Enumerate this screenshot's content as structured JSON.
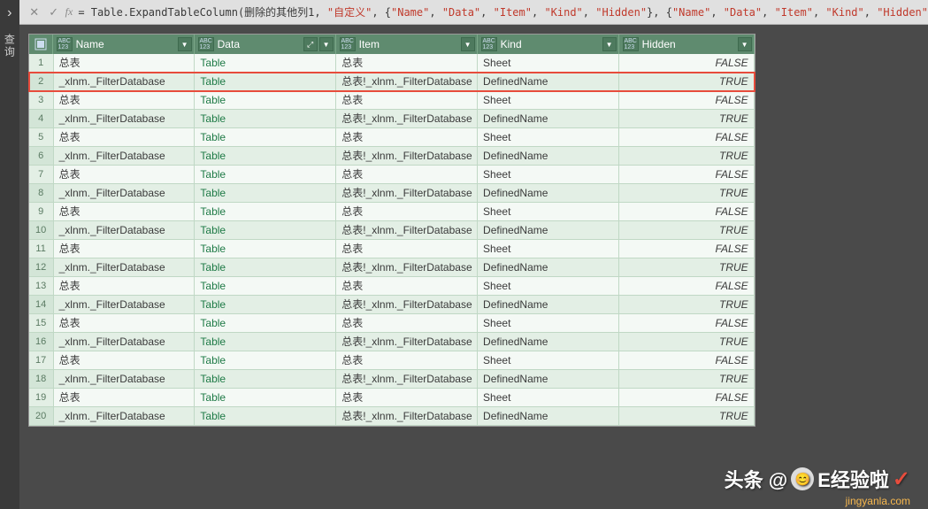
{
  "left_rail": {
    "chevron": "›",
    "label": "查询"
  },
  "formula": {
    "prefix_eq": "= ",
    "fn": "Table.ExpandTableColumn",
    "open": "(",
    "arg1": "删除的其他列1",
    "comma": ", ",
    "str_custom": "\"自定义\"",
    "list1_open": "{",
    "list1_items": [
      "\"Name\"",
      "\"Data\"",
      "\"Item\"",
      "\"Kind\"",
      "\"Hidden\""
    ],
    "list1_close": "}",
    "list2_open": "{",
    "list2_items": [
      "\"Name\"",
      "\"Data\"",
      "\"Item\"",
      "\"Kind\"",
      "\"Hidden\""
    ]
  },
  "columns": [
    {
      "key": "name",
      "label": "Name",
      "type_icon": "ABC\n123"
    },
    {
      "key": "data",
      "label": "Data",
      "type_icon": "ABC\n123",
      "expand": true
    },
    {
      "key": "item",
      "label": "Item",
      "type_icon": "ABC\n123"
    },
    {
      "key": "kind",
      "label": "Kind",
      "type_icon": "ABC\n123"
    },
    {
      "key": "hidden",
      "label": "Hidden",
      "type_icon": "ABC\n123"
    }
  ],
  "rows": [
    {
      "n": 1,
      "name": "总表",
      "data": "Table",
      "item": "总表",
      "kind": "Sheet",
      "hidden": "FALSE"
    },
    {
      "n": 2,
      "name": "_xlnm._FilterDatabase",
      "data": "Table",
      "item": "总表!_xlnm._FilterDatabase",
      "kind": "DefinedName",
      "hidden": "TRUE",
      "highlight": true
    },
    {
      "n": 3,
      "name": "总表",
      "data": "Table",
      "item": "总表",
      "kind": "Sheet",
      "hidden": "FALSE"
    },
    {
      "n": 4,
      "name": "_xlnm._FilterDatabase",
      "data": "Table",
      "item": "总表!_xlnm._FilterDatabase",
      "kind": "DefinedName",
      "hidden": "TRUE"
    },
    {
      "n": 5,
      "name": "总表",
      "data": "Table",
      "item": "总表",
      "kind": "Sheet",
      "hidden": "FALSE"
    },
    {
      "n": 6,
      "name": "_xlnm._FilterDatabase",
      "data": "Table",
      "item": "总表!_xlnm._FilterDatabase",
      "kind": "DefinedName",
      "hidden": "TRUE"
    },
    {
      "n": 7,
      "name": "总表",
      "data": "Table",
      "item": "总表",
      "kind": "Sheet",
      "hidden": "FALSE"
    },
    {
      "n": 8,
      "name": "_xlnm._FilterDatabase",
      "data": "Table",
      "item": "总表!_xlnm._FilterDatabase",
      "kind": "DefinedName",
      "hidden": "TRUE"
    },
    {
      "n": 9,
      "name": "总表",
      "data": "Table",
      "item": "总表",
      "kind": "Sheet",
      "hidden": "FALSE"
    },
    {
      "n": 10,
      "name": "_xlnm._FilterDatabase",
      "data": "Table",
      "item": "总表!_xlnm._FilterDatabase",
      "kind": "DefinedName",
      "hidden": "TRUE"
    },
    {
      "n": 11,
      "name": "总表",
      "data": "Table",
      "item": "总表",
      "kind": "Sheet",
      "hidden": "FALSE"
    },
    {
      "n": 12,
      "name": "_xlnm._FilterDatabase",
      "data": "Table",
      "item": "总表!_xlnm._FilterDatabase",
      "kind": "DefinedName",
      "hidden": "TRUE"
    },
    {
      "n": 13,
      "name": "总表",
      "data": "Table",
      "item": "总表",
      "kind": "Sheet",
      "hidden": "FALSE"
    },
    {
      "n": 14,
      "name": "_xlnm._FilterDatabase",
      "data": "Table",
      "item": "总表!_xlnm._FilterDatabase",
      "kind": "DefinedName",
      "hidden": "TRUE"
    },
    {
      "n": 15,
      "name": "总表",
      "data": "Table",
      "item": "总表",
      "kind": "Sheet",
      "hidden": "FALSE"
    },
    {
      "n": 16,
      "name": "_xlnm._FilterDatabase",
      "data": "Table",
      "item": "总表!_xlnm._FilterDatabase",
      "kind": "DefinedName",
      "hidden": "TRUE"
    },
    {
      "n": 17,
      "name": "总表",
      "data": "Table",
      "item": "总表",
      "kind": "Sheet",
      "hidden": "FALSE"
    },
    {
      "n": 18,
      "name": "_xlnm._FilterDatabase",
      "data": "Table",
      "item": "总表!_xlnm._FilterDatabase",
      "kind": "DefinedName",
      "hidden": "TRUE"
    },
    {
      "n": 19,
      "name": "总表",
      "data": "Table",
      "item": "总表",
      "kind": "Sheet",
      "hidden": "FALSE"
    },
    {
      "n": 20,
      "name": "_xlnm._FilterDatabase",
      "data": "Table",
      "item": "总表!_xlnm._FilterDatabase",
      "kind": "DefinedName",
      "hidden": "TRUE"
    }
  ],
  "watermark": {
    "prefix": "头条 @",
    "name": "E经验啦",
    "check": "✓"
  },
  "site": "jingyanla.com"
}
